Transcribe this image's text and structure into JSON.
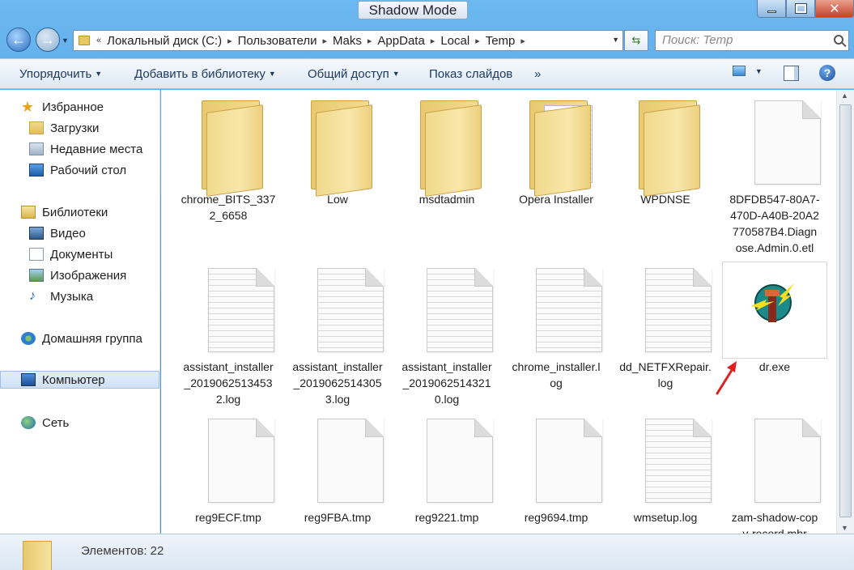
{
  "window": {
    "title": "Shadow Mode"
  },
  "address": {
    "crumbs": [
      "Локальный диск (C:)",
      "Пользователи",
      "Maks",
      "AppData",
      "Local",
      "Temp"
    ],
    "overflow": "«"
  },
  "search": {
    "placeholder": "Поиск: Temp"
  },
  "commands": {
    "organize": "Упорядочить",
    "add_library": "Добавить в библиотеку",
    "share": "Общий доступ",
    "slideshow": "Показ слайдов",
    "more": "»"
  },
  "nav": {
    "favorites": "Избранное",
    "downloads": "Загрузки",
    "recent": "Недавние места",
    "desktop": "Рабочий стол",
    "libraries": "Библиотеки",
    "video": "Видео",
    "documents": "Документы",
    "images": "Изображения",
    "music": "Музыка",
    "homegroup": "Домашняя группа",
    "computer": "Компьютер",
    "network": "Сеть"
  },
  "files": [
    {
      "name": "chrome_BITS_337\n2_6658",
      "type": "folder"
    },
    {
      "name": "Low",
      "type": "folder"
    },
    {
      "name": "msdtadmin",
      "type": "folder"
    },
    {
      "name": "Opera Installer",
      "type": "folder-docs"
    },
    {
      "name": "WPDNSE",
      "type": "folder"
    },
    {
      "name": "8DFDB547-80A7-\n470D-A40B-20A2\n770587B4.Diagn\nose.Admin.0.etl",
      "type": "file"
    },
    {
      "name": "assistant_installer\n_2019062513453\n2.log",
      "type": "text"
    },
    {
      "name": "assistant_installer\n_2019062514305\n3.log",
      "type": "text"
    },
    {
      "name": "assistant_installer\n_2019062514321\n0.log",
      "type": "text"
    },
    {
      "name": "chrome_installer.l\nog",
      "type": "text"
    },
    {
      "name": "dd_NETFXRepair.\nlog",
      "type": "text"
    },
    {
      "name": "dr.exe",
      "type": "exe"
    },
    {
      "name": "reg9ECF.tmp",
      "type": "file"
    },
    {
      "name": "reg9FBA.tmp",
      "type": "file"
    },
    {
      "name": "reg9221.tmp",
      "type": "file"
    },
    {
      "name": "reg9694.tmp",
      "type": "file"
    },
    {
      "name": "wmsetup.log",
      "type": "text"
    },
    {
      "name": "zam-shadow-cop\ny-record.mbr",
      "type": "file"
    }
  ],
  "status": {
    "count": "Элементов: 22"
  },
  "colors": {
    "frame": "#4d9fe2",
    "arrow": "#e02020"
  }
}
